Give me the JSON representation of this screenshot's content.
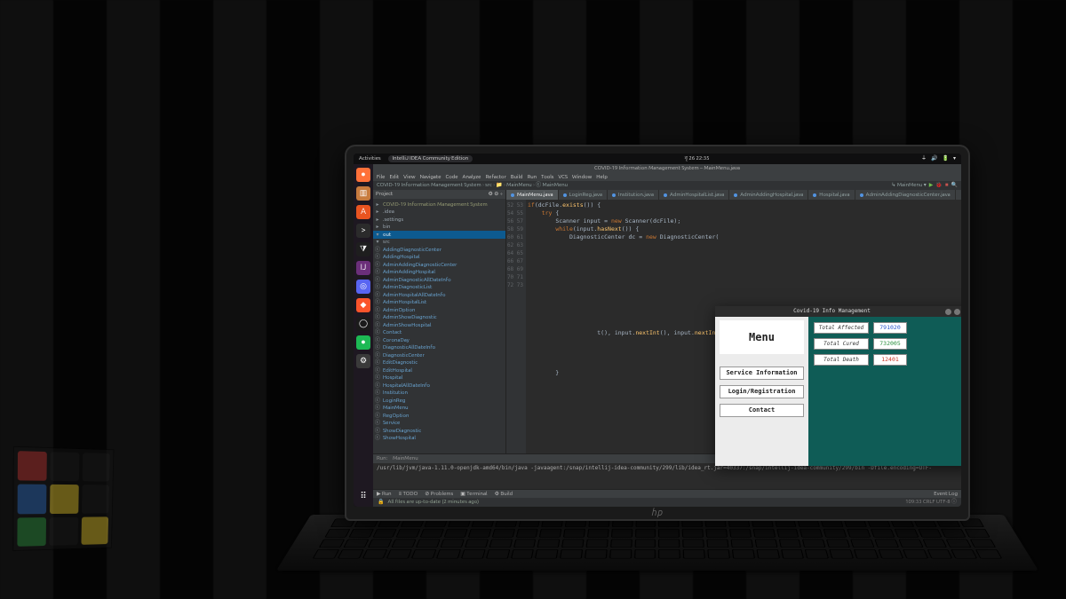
{
  "topbar": {
    "activities": "Activities",
    "app_pill": "IntelliJ IDEA Community Edition",
    "clock": "বৃ 26  22:35"
  },
  "dock_icons": [
    {
      "name": "firefox-icon",
      "bg": "#ff7139",
      "glyph": "●"
    },
    {
      "name": "files-icon",
      "bg": "#c77b3e",
      "glyph": "▥"
    },
    {
      "name": "software-icon",
      "bg": "#e95420",
      "glyph": "A"
    },
    {
      "name": "terminal-icon",
      "bg": "#2b2b2b",
      "glyph": ">"
    },
    {
      "name": "vscode-icon",
      "bg": "#1e1e1e",
      "glyph": "⧩"
    },
    {
      "name": "intellij-icon",
      "bg": "#6b2f7a",
      "glyph": "IJ"
    },
    {
      "name": "discord-icon",
      "bg": "#5865f2",
      "glyph": "◎"
    },
    {
      "name": "brave-icon",
      "bg": "#fb542b",
      "glyph": "◆"
    },
    {
      "name": "obs-icon",
      "bg": "#1b1b1b",
      "glyph": "◯"
    },
    {
      "name": "spotify-icon",
      "bg": "#1db954",
      "glyph": "●"
    },
    {
      "name": "gear-icon",
      "bg": "#3a3a3a",
      "glyph": "⚙"
    }
  ],
  "ide": {
    "title": "COVID-19 Information Management System – MainMenu.java",
    "menu": [
      "File",
      "Edit",
      "View",
      "Navigate",
      "Code",
      "Analyze",
      "Refactor",
      "Build",
      "Run",
      "Tools",
      "VCS",
      "Window",
      "Help"
    ],
    "crumbs": [
      "COVID-19 Information Management System",
      "src",
      "📁",
      "MainMenu",
      "ⓒ MainMenu"
    ],
    "run_config": "MainMenu",
    "project_header": "Project",
    "tree": [
      {
        "d": 1,
        "icon": "▸",
        "label": "COVID-19 Information Management System",
        "cls": "pkg bold"
      },
      {
        "d": 2,
        "icon": "▸",
        "label": ".idea",
        "cls": ""
      },
      {
        "d": 2,
        "icon": "▸",
        "label": ".settings",
        "cls": ""
      },
      {
        "d": 2,
        "icon": "▸",
        "label": "bin",
        "cls": ""
      },
      {
        "d": 2,
        "icon": "▾",
        "label": "out",
        "cls": "",
        "sel": true
      },
      {
        "d": 2,
        "icon": "▾",
        "label": "src",
        "cls": ""
      },
      {
        "d": 3,
        "icon": "ⓒ",
        "label": "AddingDiagnosticCenter",
        "cls": "cls"
      },
      {
        "d": 3,
        "icon": "ⓒ",
        "label": "AddingHospital",
        "cls": "cls"
      },
      {
        "d": 3,
        "icon": "ⓒ",
        "label": "AdminAddingDiagnosticCenter",
        "cls": "cls"
      },
      {
        "d": 3,
        "icon": "ⓒ",
        "label": "AdminAddingHospital",
        "cls": "cls"
      },
      {
        "d": 3,
        "icon": "ⓒ",
        "label": "AdminDiagnosticAllDateInfo",
        "cls": "cls"
      },
      {
        "d": 3,
        "icon": "ⓒ",
        "label": "AdminDiagnosticList",
        "cls": "cls"
      },
      {
        "d": 3,
        "icon": "ⓒ",
        "label": "AdminHospitalAllDateInfo",
        "cls": "cls"
      },
      {
        "d": 3,
        "icon": "ⓒ",
        "label": "AdminHospitalList",
        "cls": "cls"
      },
      {
        "d": 3,
        "icon": "ⓒ",
        "label": "AdminOption",
        "cls": "cls"
      },
      {
        "d": 3,
        "icon": "ⓒ",
        "label": "AdminShowDiagnostic",
        "cls": "cls"
      },
      {
        "d": 3,
        "icon": "ⓒ",
        "label": "AdminShowHospital",
        "cls": "cls"
      },
      {
        "d": 3,
        "icon": "ⓒ",
        "label": "Contact",
        "cls": "cls"
      },
      {
        "d": 3,
        "icon": "ⓒ",
        "label": "CoronaDay",
        "cls": "cls"
      },
      {
        "d": 3,
        "icon": "ⓒ",
        "label": "DiagnosticAllDateInfo",
        "cls": "cls"
      },
      {
        "d": 3,
        "icon": "ⓒ",
        "label": "DiagnosticCenter",
        "cls": "cls"
      },
      {
        "d": 3,
        "icon": "ⓒ",
        "label": "EditDiagnostic",
        "cls": "cls"
      },
      {
        "d": 3,
        "icon": "ⓒ",
        "label": "EditHospital",
        "cls": "cls"
      },
      {
        "d": 3,
        "icon": "ⓒ",
        "label": "Hospital",
        "cls": "cls"
      },
      {
        "d": 3,
        "icon": "ⓒ",
        "label": "HospitalAllDateInfo",
        "cls": "cls"
      },
      {
        "d": 3,
        "icon": "ⓒ",
        "label": "Institution",
        "cls": "cls"
      },
      {
        "d": 3,
        "icon": "ⓒ",
        "label": "LoginReg",
        "cls": "cls"
      },
      {
        "d": 3,
        "icon": "ⓒ",
        "label": "MainMenu",
        "cls": "cls"
      },
      {
        "d": 3,
        "icon": "ⓒ",
        "label": "RegOption",
        "cls": "cls"
      },
      {
        "d": 3,
        "icon": "ⓒ",
        "label": "Service",
        "cls": "cls"
      },
      {
        "d": 3,
        "icon": "ⓒ",
        "label": "ShowDiagnostic",
        "cls": "cls"
      },
      {
        "d": 3,
        "icon": "ⓒ",
        "label": "ShowHospital",
        "cls": "cls"
      }
    ],
    "tabs": [
      {
        "label": "MainMenu.java",
        "active": true
      },
      {
        "label": "LoginReg.java"
      },
      {
        "label": "Institution.java"
      },
      {
        "label": "AdminHospitalList.java"
      },
      {
        "label": "AdminAddingHospital.java"
      },
      {
        "label": "Hospital.java"
      },
      {
        "label": "AdminAddingDiagnosticCenter.java"
      }
    ],
    "gutter_start": 52,
    "code_lines": [
      "if(dcFile.exists()) {",
      "    try {",
      "        Scanner input = new Scanner(dcFile);",
      "        while(input.hasNext()) {",
      "            DiagnosticCenter dc = new DiagnosticCenter(",
      "",
      "",
      "",
      "",
      "",
      "",
      "",
      "",
      "",
      "",
      "",
      "                    t(), input.nextInt(), input.nextInt(), input",
      "",
      "",
      "",
      "",
      "        }"
    ],
    "run": {
      "label": "Run:",
      "config": "MainMenu",
      "output": "/usr/lib/jvm/java-1.11.0-openjdk-amd64/bin/java -javaagent:/snap/intellij-idea-community/299/lib/idea_rt.jar=40337:/snap/intellij-idea-community/299/bin -Dfile.encoding=UTF-"
    },
    "bottom_tabs": [
      "▶ Run",
      "≡ TODO",
      "⊘ Problems",
      "▣ Terminal",
      "⚙ Build"
    ],
    "bottom_right": "Event Log",
    "status_left": "All files are up-to-date (2 minutes ago)",
    "status_right": "109:33  CRLF  UTF-8  ⓘ"
  },
  "swing": {
    "title": "Covid-19 Info Management",
    "menu_label": "Menu",
    "buttons": [
      "Service Information",
      "Login/Registration",
      "Contact"
    ],
    "stats": [
      {
        "label": "Total Affected",
        "value": "791020",
        "cls": "v-aff"
      },
      {
        "label": "Total Cured",
        "value": "732005",
        "cls": "v-cur"
      },
      {
        "label": "Total Death",
        "value": "12401",
        "cls": "v-dth"
      }
    ]
  },
  "laptop_brand": "hp"
}
